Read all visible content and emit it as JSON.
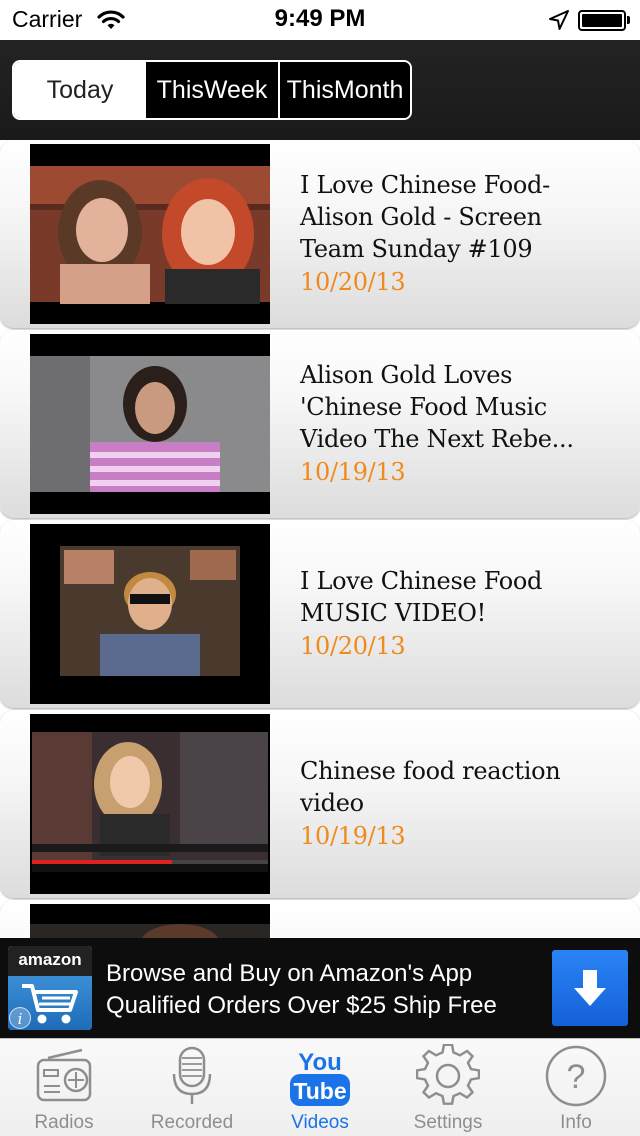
{
  "status_bar": {
    "carrier": "Carrier",
    "time": "9:49 PM",
    "battery_level": 1.0
  },
  "segments": {
    "items": [
      "Today",
      "ThisWeek",
      "ThisMonth"
    ],
    "selected": "Today"
  },
  "videos": [
    {
      "title": "I Love Chinese Food- Alison Gold - Screen Team Sunday #109",
      "date": "10/20/13"
    },
    {
      "title": "Alison Gold Loves 'Chinese Food Music Video The Next Rebe...",
      "date": "10/19/13"
    },
    {
      "title": "I Love Chinese Food MUSIC VIDEO!",
      "date": "10/20/13"
    },
    {
      "title": "Chinese food reaction video",
      "date": "10/19/13"
    },
    {
      "title": "",
      "date": ""
    }
  ],
  "ad": {
    "logo_text": "amazon",
    "line1": "Browse and Buy on Amazon's App",
    "line2": "Qualified Orders Over $25 Ship Free"
  },
  "tab_bar": {
    "items": [
      {
        "label": "Radios",
        "icon": "radio-icon"
      },
      {
        "label": "Recorded",
        "icon": "microphone-icon"
      },
      {
        "label": "Videos",
        "icon": "youtube-icon"
      },
      {
        "label": "Settings",
        "icon": "gear-icon"
      },
      {
        "label": "Info",
        "icon": "question-icon"
      }
    ],
    "active": "Videos"
  },
  "colors": {
    "accent": "#1a73e8",
    "date": "#f08a1c",
    "header_bg": "#1e1e1e",
    "ad_button": "#1f6ee6"
  }
}
